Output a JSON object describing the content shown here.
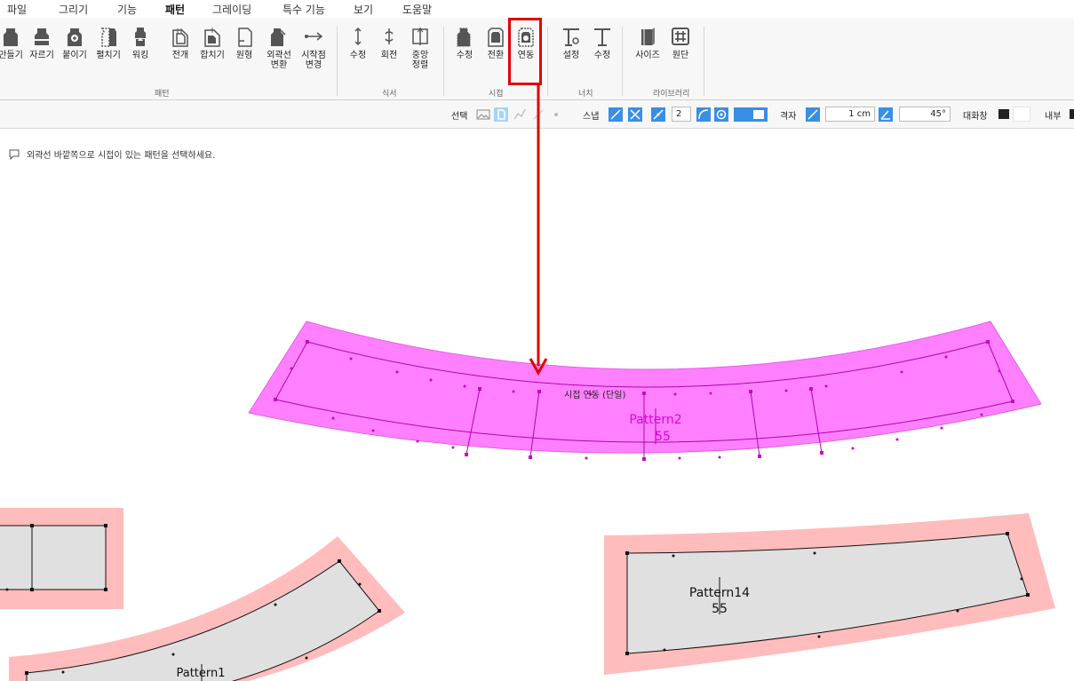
{
  "menu": {
    "items": [
      "파일",
      "그리기",
      "기능",
      "패턴",
      "그레이딩",
      "특수 기능",
      "보기",
      "도움말"
    ],
    "active": "패턴"
  },
  "ribbon": {
    "groups": {
      "pattern": {
        "label": "패턴",
        "buttons": [
          "만들기",
          "자르기",
          "붙이기",
          "펼치기",
          "워킹",
          "전개",
          "합치기",
          "원형",
          "외곽선\n변환",
          "시작점\n변경"
        ]
      },
      "notation": {
        "label": "식서",
        "buttons": [
          "수정",
          "회전",
          "중앙\n정렬"
        ]
      },
      "seam": {
        "label": "시접",
        "buttons": [
          "수정",
          "전환",
          "연동"
        ]
      },
      "notch": {
        "label": "너치",
        "buttons": [
          "설정",
          "수정"
        ]
      },
      "library": {
        "label": "라이브러리",
        "buttons": [
          "사이즈",
          "원단"
        ]
      }
    }
  },
  "toolbar": {
    "select_label": "선택",
    "snap_label": "스냅",
    "snap_value": "2",
    "grid_label": "격자",
    "grid_value": "1 cm",
    "angle_value": "45°",
    "dialog_label": "대화창",
    "inner_label": "내부"
  },
  "canvas": {
    "prompt": "외곽선 바깥쪽으로 시접이 있는 패턴을 선택하세요.",
    "tooltip": "시접 연동 (단일)",
    "patterns": [
      {
        "name": "Pattern2",
        "size": "55",
        "state": "selected"
      },
      {
        "name": "Pattern14",
        "size": "55",
        "state": "normal"
      },
      {
        "name": "Pattern1",
        "size": "",
        "state": "normal"
      }
    ]
  },
  "colors": {
    "accent": "#1a73c8",
    "highlight": "#e00000",
    "selected_fill": "#ff80ff",
    "selected_stroke": "#cc00cc",
    "seam_fill": "#ffbcbc",
    "pattern_fill": "#e0e0e0"
  }
}
